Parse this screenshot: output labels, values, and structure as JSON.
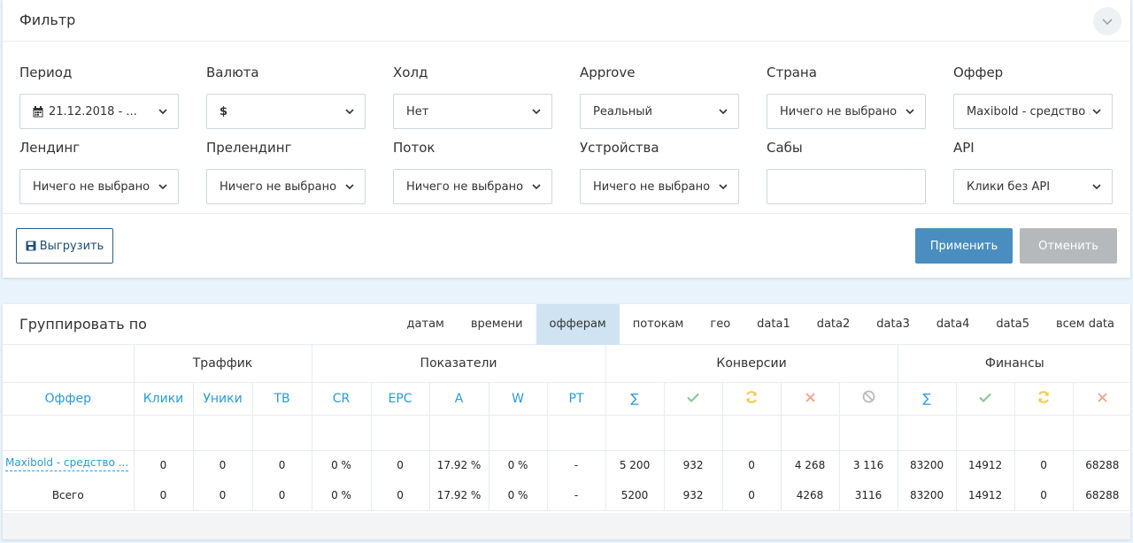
{
  "filter": {
    "title": "Фильтр",
    "fields": {
      "period": {
        "label": "Период",
        "value": "21.12.2018 - ..."
      },
      "currency": {
        "label": "Валюта",
        "value": "$"
      },
      "hold": {
        "label": "Холд",
        "value": "Нет"
      },
      "approve": {
        "label": "Approve",
        "value": "Реальный"
      },
      "country": {
        "label": "Страна",
        "value": "Ничего не выбрано"
      },
      "offer": {
        "label": "Оффер",
        "value": "Maxibold - средство ..."
      },
      "landing": {
        "label": "Лендинг",
        "value": "Ничего не выбрано"
      },
      "prelanding": {
        "label": "Прелендинг",
        "value": "Ничего не выбрано"
      },
      "stream": {
        "label": "Поток",
        "value": "Ничего не выбрано"
      },
      "devices": {
        "label": "Устройства",
        "value": "Ничего не выбрано"
      },
      "subs": {
        "label": "Сабы",
        "value": ""
      },
      "api": {
        "label": "API",
        "value": "Клики без API"
      }
    },
    "export_label": "Выгрузить",
    "apply_label": "Применить",
    "cancel_label": "Отменить"
  },
  "grouping": {
    "title": "Группировать по",
    "tabs": [
      "датам",
      "времени",
      "офферам",
      "потокам",
      "гео",
      "data1",
      "data2",
      "data3",
      "data4",
      "data5",
      "всем data"
    ],
    "active_tab": "офферам"
  },
  "table": {
    "groups": {
      "traffic": "Траффик",
      "indicators": "Показатели",
      "conversions": "Конверсии",
      "finance": "Финансы"
    },
    "columns": {
      "offer": "Оффер",
      "clicks": "Клики",
      "uniques": "Уники",
      "tb": "ТВ",
      "cr": "CR",
      "epc": "EPC",
      "a": "A",
      "w": "W",
      "pt": "PT",
      "conv_sum": "∑",
      "fin_sum": "∑"
    },
    "rows": [
      [
        "Maxibold - средство ...",
        "0",
        "0",
        "0",
        "0 %",
        "0",
        "17.92 %",
        "0 %",
        "-",
        "5 200",
        "932",
        "0",
        "4 268",
        "3 116",
        "83200",
        "14912",
        "0",
        "68288"
      ],
      [
        "Всего",
        "0",
        "0",
        "0",
        "0 %",
        "0",
        "17.92 %",
        "0 %",
        "-",
        "5200",
        "932",
        "0",
        "4268",
        "3116",
        "83200",
        "14912",
        "0",
        "68288"
      ]
    ]
  },
  "colors": {
    "accent": "#2a9bd7",
    "apply": "#4a8dc0",
    "cancel": "#b6b9bb",
    "approved": "#8cc79a",
    "pending": "#f3c94a",
    "rejected": "#f0a898",
    "trash": "#bbbbbb"
  },
  "icons": {
    "approved": "check-icon",
    "pending": "refresh-icon",
    "rejected": "cross-icon",
    "trash": "ban-icon"
  }
}
